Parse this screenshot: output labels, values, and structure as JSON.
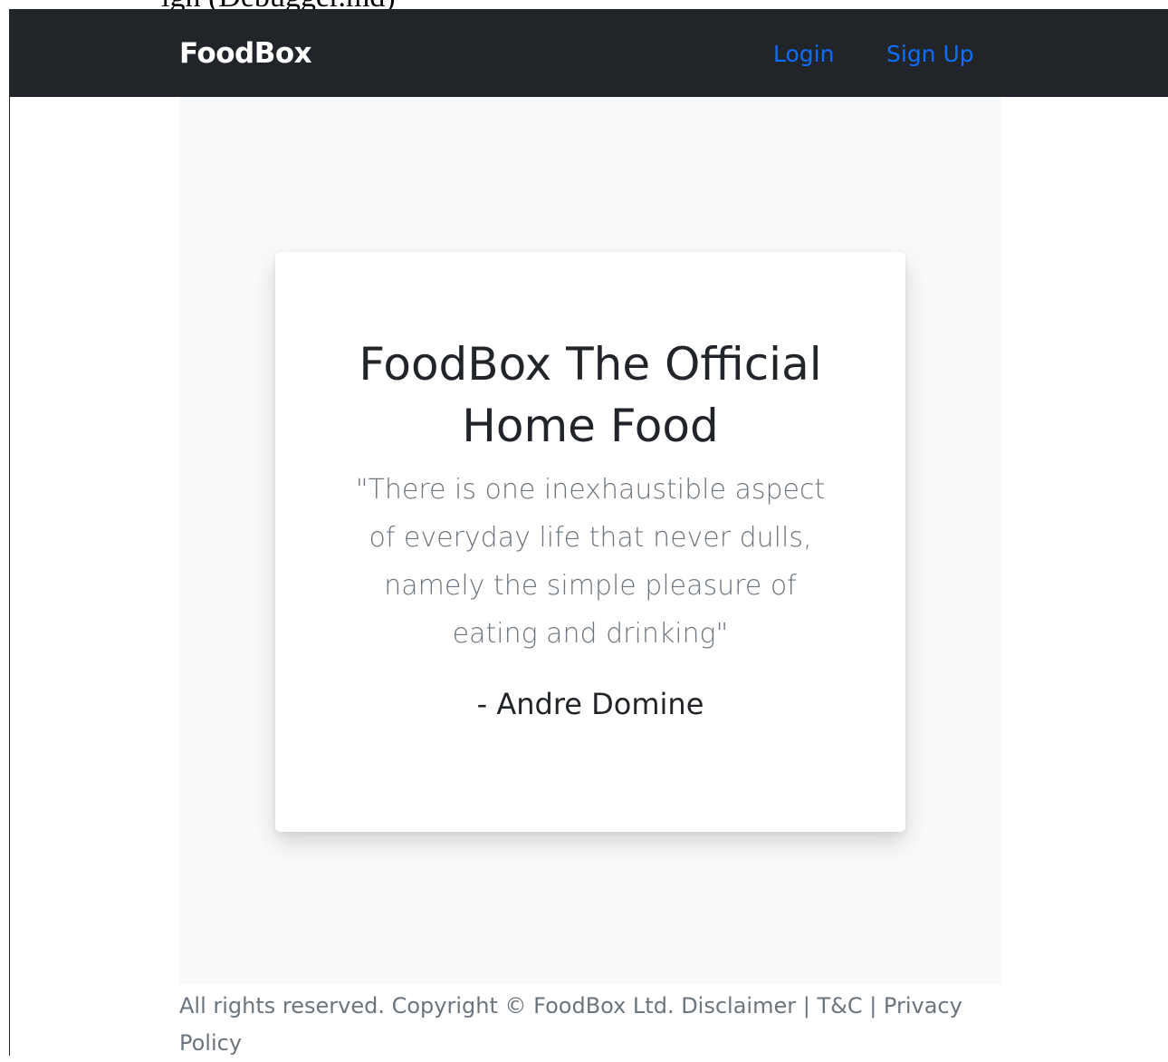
{
  "page_top_clip": {
    "text": "ign (Debugger.md)"
  },
  "navbar": {
    "brand": "FoodBox",
    "links": [
      {
        "label": "Login"
      },
      {
        "label": "Sign Up"
      }
    ],
    "background_color": "#212529",
    "link_color": "#0d6efd"
  },
  "hero": {
    "background_color": "#f8f9fa",
    "card": {
      "title": "FoodBox The Official Home Food",
      "quote": "\"There is one inexhaustible aspect of everyday life that never dulls, namely the simple pleasure of eating and drinking\"",
      "author": "- Andre Domine"
    }
  },
  "footer": {
    "text": "All rights reserved. Copyright © FoodBox Ltd. Disclaimer | T&C | Privacy Policy"
  }
}
